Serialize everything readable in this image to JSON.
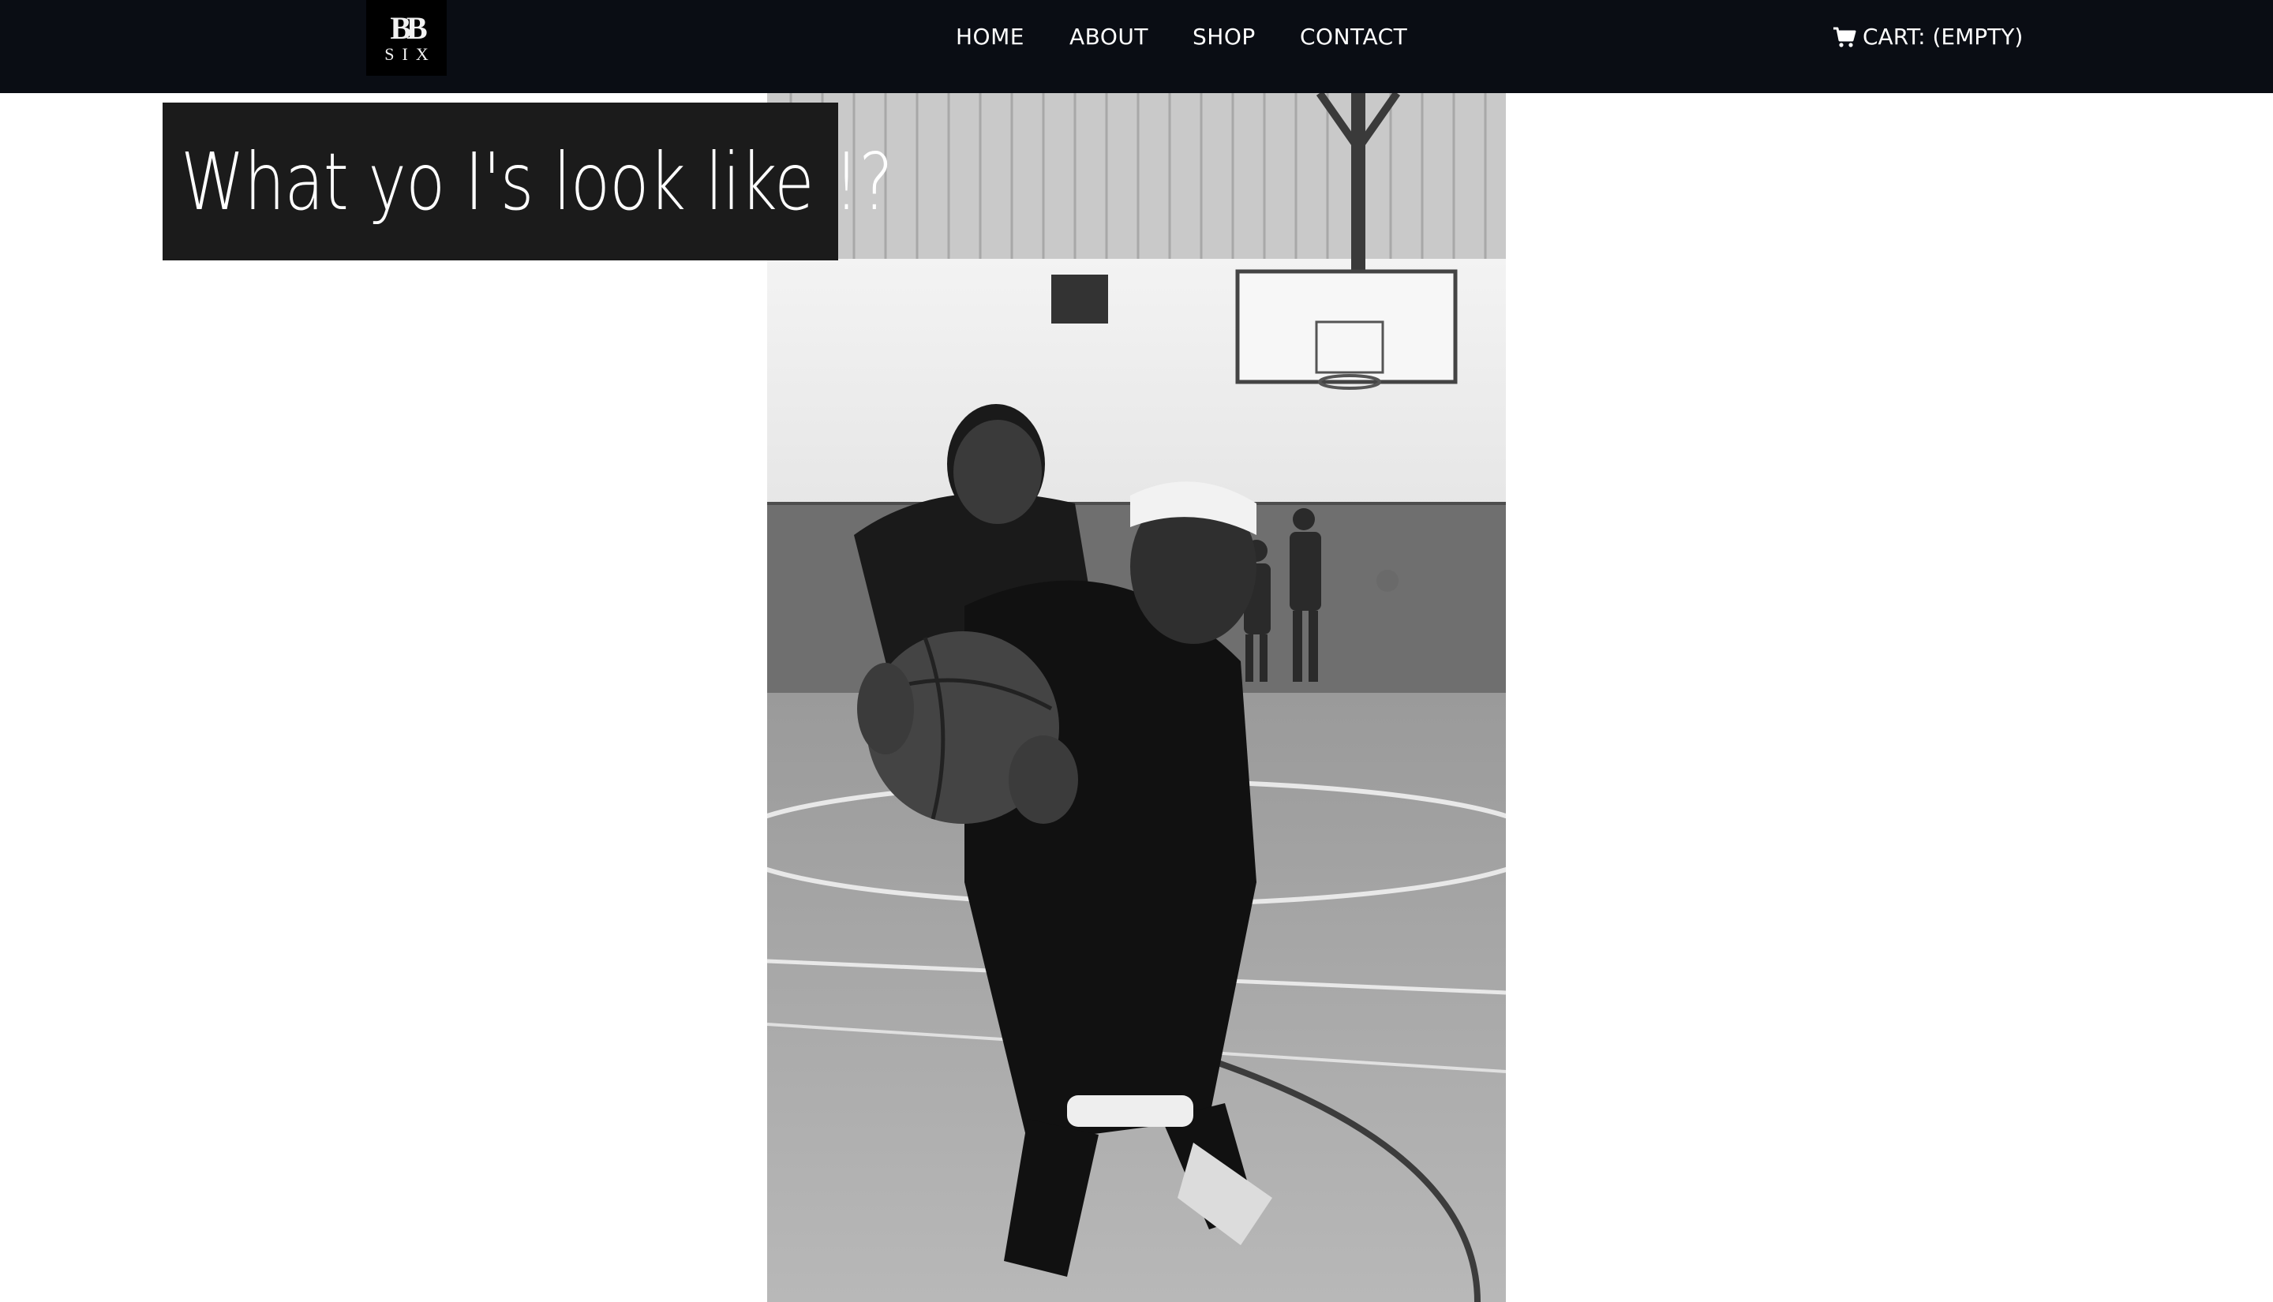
{
  "header": {
    "logo": {
      "mark": "BB",
      "subtitle": "SIX"
    },
    "nav": [
      {
        "label": "HOME"
      },
      {
        "label": "ABOUT"
      },
      {
        "label": "SHOP"
      },
      {
        "label": "CONTACT"
      }
    ],
    "cart": {
      "icon": "shopping-cart-icon",
      "label": "CART: (EMPTY)"
    }
  },
  "hero": {
    "caption": "What yo I's look like !?",
    "media": "basketball-video"
  },
  "colors": {
    "header_bg": "#0a0d14",
    "caption_bg": "#1b1b1b",
    "page_bg": "#ffffff",
    "text_light": "#ffffff"
  }
}
